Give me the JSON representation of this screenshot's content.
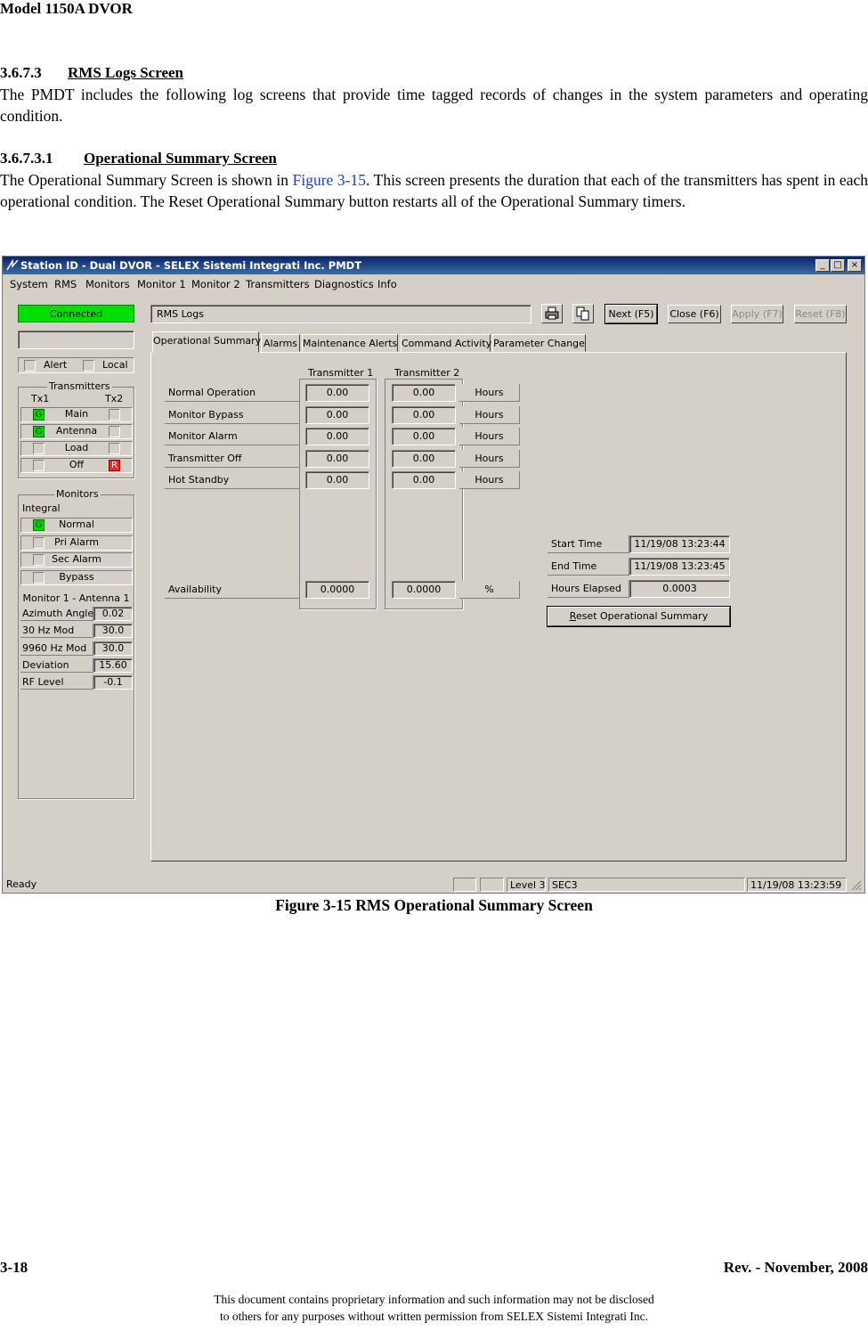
{
  "header": {
    "doc_title": "Model 1150A DVOR"
  },
  "sections": [
    {
      "number": "3.6.7.3",
      "title": "RMS Logs Screen",
      "body": "The PMDT includes the following log screens that provide time tagged records of changes in the system parameters and operating condition."
    },
    {
      "number": "3.6.7.3.1",
      "title": "Operational Summary Screen",
      "body_pre": "The Operational Summary Screen is shown in ",
      "body_link": "Figure 3-15",
      "body_post": ". This screen presents the duration that each of the transmitters has spent in each operational condition. The Reset Operational Summary button restarts all of the Operational Summary timers."
    }
  ],
  "window": {
    "title": "Station ID - Dual DVOR - SELEX Sistemi Integrati Inc. PMDT",
    "controls": {
      "minimize": "_",
      "maximize": "□",
      "close": "×"
    },
    "menu": [
      "System",
      "RMS",
      "Monitors",
      "Monitor 1",
      "Monitor 2",
      "Transmitters",
      "Diagnostics",
      "Info"
    ],
    "left_panel": {
      "connection_status": "Connected",
      "alert_label": "Alert",
      "local_label": "Local",
      "transmitters": {
        "group_title": "Transmitters",
        "tx1": "Tx1",
        "tx2": "Tx2",
        "rows": [
          {
            "label": "Main",
            "tx1": "G",
            "tx2": ""
          },
          {
            "label": "Antenna",
            "tx1": "G",
            "tx2": ""
          },
          {
            "label": "Load",
            "tx1": "",
            "tx2": ""
          },
          {
            "label": "Off",
            "tx1": "",
            "tx2": "R"
          }
        ]
      },
      "monitors": {
        "group_title": "Monitors",
        "integral_label": "Integral",
        "rows": [
          {
            "label": "Normal",
            "led": "G"
          },
          {
            "label": "Pri Alarm",
            "led": ""
          },
          {
            "label": "Sec Alarm",
            "led": ""
          },
          {
            "label": "Bypass",
            "led": ""
          }
        ],
        "monitor_title": "Monitor 1 - Antenna 1",
        "params": [
          {
            "label": "Azimuth Angle",
            "value": "0.02"
          },
          {
            "label": "30 Hz Mod",
            "value": "30.0"
          },
          {
            "label": "9960 Hz Mod",
            "value": "30.0"
          },
          {
            "label": "Deviation",
            "value": "15.60"
          },
          {
            "label": "RF Level",
            "value": "-0.1"
          }
        ]
      }
    },
    "toolbar": {
      "screen_name": "RMS Logs",
      "print_icon": "printer-icon",
      "copy_icon": "copy-icon",
      "next": "Next (F5)",
      "close": "Close (F6)",
      "apply": "Apply (F7)",
      "reset": "Reset (F8)"
    },
    "tabs": [
      "Operational Summary",
      "Alarms",
      "Maintenance Alerts",
      "Command Activity",
      "Parameter Change"
    ],
    "summary": {
      "tx1_title": "Transmitter 1",
      "tx2_title": "Transmitter 2",
      "rows": [
        {
          "label": "Normal Operation",
          "tx1": "0.00",
          "tx2": "0.00",
          "unit": "Hours"
        },
        {
          "label": "Monitor Bypass",
          "tx1": "0.00",
          "tx2": "0.00",
          "unit": "Hours"
        },
        {
          "label": "Monitor Alarm",
          "tx1": "0.00",
          "tx2": "0.00",
          "unit": "Hours"
        },
        {
          "label": "Transmitter Off",
          "tx1": "0.00",
          "tx2": "0.00",
          "unit": "Hours"
        },
        {
          "label": "Hot Standby",
          "tx1": "0.00",
          "tx2": "0.00",
          "unit": "Hours"
        }
      ],
      "availability": {
        "label": "Availability",
        "tx1": "0.0000",
        "tx2": "0.0000",
        "unit": "%"
      },
      "times": [
        {
          "label": "Start Time",
          "value": "11/19/08 13:23:44"
        },
        {
          "label": "End Time",
          "value": "11/19/08 13:23:45"
        },
        {
          "label": "Hours Elapsed",
          "value": "0.0003"
        }
      ],
      "reset_button_underline": "R",
      "reset_button_rest": "eset Operational Summary"
    },
    "statusbar": {
      "status": "Ready",
      "level": "Level 3",
      "user": "SEC3",
      "datetime": "11/19/08 13:23:59"
    }
  },
  "caption": "Figure 3-15  RMS Operational Summary Screen",
  "footer": {
    "page": "3-18",
    "revision": "Rev. -  November, 2008",
    "disclaimer_line1": "This document contains proprietary information and such information may not be disclosed",
    "disclaimer_line2": "to others for any purposes without written permission from SELEX Sistemi Integrati Inc."
  }
}
